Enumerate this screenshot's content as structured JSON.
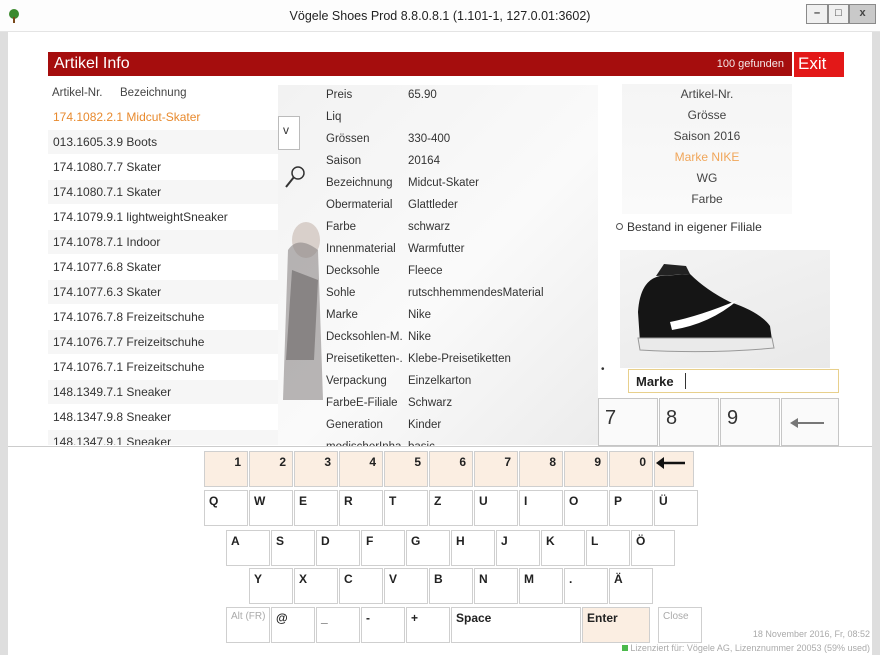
{
  "window": {
    "title": "Vögele Shoes Prod 8.8.0.8.1 (1.101-1, 127.0.01:3602)",
    "min_label": "–",
    "max_label": "□",
    "close_label": "x"
  },
  "header": {
    "title": "Artikel Info",
    "found": "100 gefunden",
    "exit": "Exit"
  },
  "list": {
    "col_article": "Artikel-Nr.",
    "col_desc": "Bezeichnung",
    "rows": [
      "174.1082.2.1 Midcut-Skater",
      "013.1605.3.9 Boots",
      "174.1080.7.7 Skater",
      "174.1080.7.1 Skater",
      "174.1079.9.1 lightweightSneaker",
      "174.1078.7.1 Indoor",
      "174.1077.6.8 Skater",
      "174.1077.6.3 Skater",
      "174.1076.7.8 Freizeitschuhe",
      "174.1076.7.7 Freizeitschuhe",
      "174.1076.7.1 Freizeitschuhe",
      "148.1349.7.1 Sneaker",
      "148.1347.9.8 Sneaker",
      "148.1347.9.1 Sneaker"
    ]
  },
  "v_button": "v",
  "details": [
    {
      "k": "Preis",
      "v": "65.90"
    },
    {
      "k": "Liq",
      "v": ""
    },
    {
      "k": "Grössen",
      "v": "330-400"
    },
    {
      "k": "Saison",
      "v": "20164"
    },
    {
      "k": "Bezeichnung",
      "v": "Midcut-Skater"
    },
    {
      "k": "Obermaterial",
      "v": "Glattleder"
    },
    {
      "k": "Farbe",
      "v": "schwarz"
    },
    {
      "k": "Innenmaterial",
      "v": "Warmfutter"
    },
    {
      "k": "Decksohle",
      "v": "Fleece"
    },
    {
      "k": "Sohle",
      "v": "rutschhemmendesMaterial"
    },
    {
      "k": "Marke",
      "v": "Nike"
    },
    {
      "k": "Decksohlen-M.",
      "v": "Nike"
    },
    {
      "k": "Preisetiketten-.",
      "v": "Klebe-Preisetiketten"
    },
    {
      "k": "Verpackung",
      "v": "Einzelkarton"
    },
    {
      "k": "FarbeE-Filiale",
      "v": "Schwarz"
    },
    {
      "k": "Generation",
      "v": "Kinder"
    },
    {
      "k": "modischerInha",
      "v": "basic"
    }
  ],
  "right_panel": {
    "lines": [
      "Artikel-Nr.",
      "Grösse",
      "Saison 2016",
      "Marke NIKE",
      "WG",
      "Farbe"
    ],
    "highlight_index": 3,
    "bestand": "Bestand in eigener Filiale",
    "marke_label": "Marke",
    "marke_value": ""
  },
  "numpad": [
    "7",
    "8",
    "9"
  ],
  "keyboard": {
    "row_numbers": [
      "1",
      "2",
      "3",
      "4",
      "5",
      "6",
      "7",
      "8",
      "9",
      "0"
    ],
    "row1": [
      "Q",
      "W",
      "E",
      "R",
      "T",
      "Z",
      "U",
      "I",
      "O",
      "P",
      "Ü"
    ],
    "row2": [
      "A",
      "S",
      "D",
      "F",
      "G",
      "H",
      "J",
      "K",
      "L",
      "Ö"
    ],
    "row3": [
      "Y",
      "X",
      "C",
      "V",
      "B",
      "N",
      "M",
      ".",
      "Ä"
    ],
    "bottom": {
      "alt": "Alt (FR)",
      "at": "@",
      "underscore": "_",
      "dash": "-",
      "plus": "+",
      "space": "Space",
      "enter": "Enter",
      "close": "Close"
    }
  },
  "status": {
    "date": "18 November 2016, Fr, 08:52",
    "license": "Lizenziert für: Vögele AG, Lizenznummer 20053 (59% used)"
  }
}
